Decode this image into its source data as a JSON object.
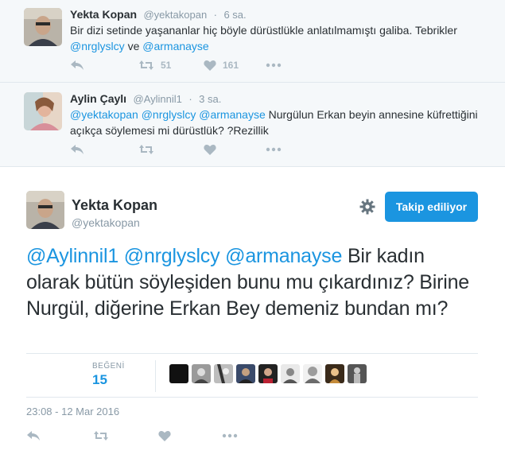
{
  "replies": [
    {
      "name": "Yekta Kopan",
      "handle": "@yektakopan",
      "dot": "·",
      "time": "6 sa.",
      "text_plain": "Bir dizi setinde yaşananlar hiç böyle dürüstlükle anlatılmamıştı galiba. Tebrikler",
      "mention1": "@nrglyslcy",
      "connector": "ve",
      "mention2": "@armanayse",
      "retweets": "51",
      "likes": "161"
    },
    {
      "name": "Aylin Çaylı",
      "handle": "@Aylinnil1",
      "dot": "·",
      "time": "3 sa.",
      "mentions": "@yektakopan @nrglyslcy @armanayse",
      "text_plain": "Nurgülun  Erkan beyin annesine küfrettiğini açıkça söylemesi mi dürüstlük? ?Rezillik"
    }
  ],
  "main": {
    "name": "Yekta Kopan",
    "handle": "@yektakopan",
    "follow_label": "Takip ediliyor",
    "mentions": "@Aylinnil1 @nrglyslcy @armanayse",
    "text_plain": "Bir kadın olarak bütün söyleşiden bunu mu çıkardınız? Birine Nurgül, diğerine Erkan Bey demeniz bundan mı?",
    "likes_label": "BEĞENİ",
    "likes_count": "15",
    "timestamp": "23:08 - 12 Mar 2016"
  },
  "colors": {
    "accent": "#1b95e0",
    "muted": "#8899a6",
    "icon": "#aab8c2",
    "reply_bg": "#f5f8fa"
  },
  "icons": [
    "reply-icon",
    "retweet-icon",
    "heart-icon",
    "more-icon",
    "gear-icon"
  ]
}
